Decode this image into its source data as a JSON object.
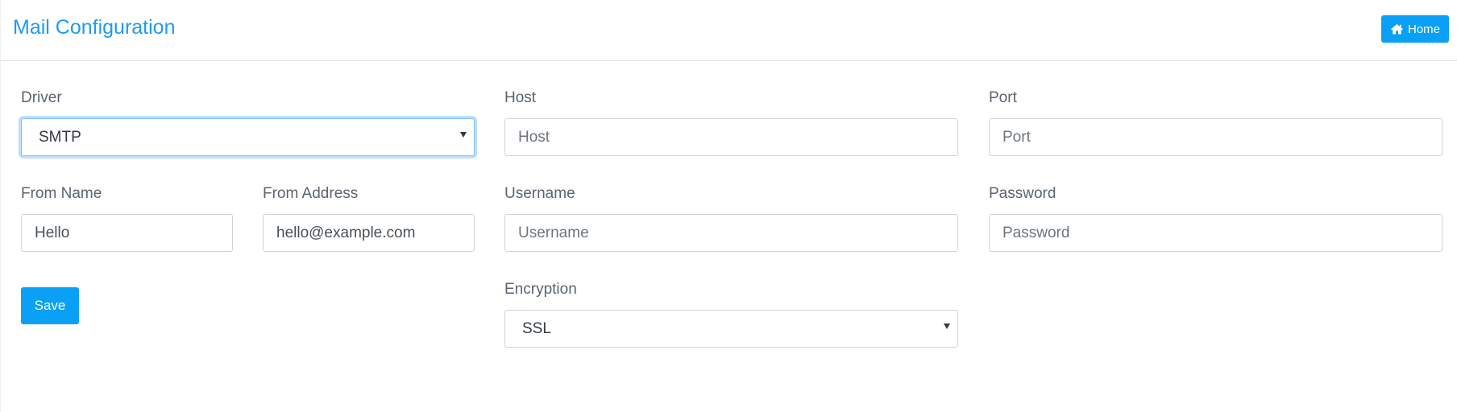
{
  "header": {
    "title": "Mail Configuration",
    "home_label": "Home",
    "home_icon": "home-icon"
  },
  "form": {
    "driver": {
      "label": "Driver",
      "value": "SMTP"
    },
    "host": {
      "label": "Host",
      "placeholder": "Host",
      "value": ""
    },
    "port": {
      "label": "Port",
      "placeholder": "Port",
      "value": ""
    },
    "from_name": {
      "label": "From Name",
      "value": "Hello"
    },
    "from_address": {
      "label": "From Address",
      "value": "hello@example.com"
    },
    "username": {
      "label": "Username",
      "placeholder": "Username",
      "value": ""
    },
    "password": {
      "label": "Password",
      "placeholder": "Password",
      "value": ""
    },
    "encryption": {
      "label": "Encryption",
      "value": "SSL"
    },
    "save_label": "Save"
  },
  "colors": {
    "accent": "#0aa0f5",
    "title": "#1e9bf0"
  }
}
